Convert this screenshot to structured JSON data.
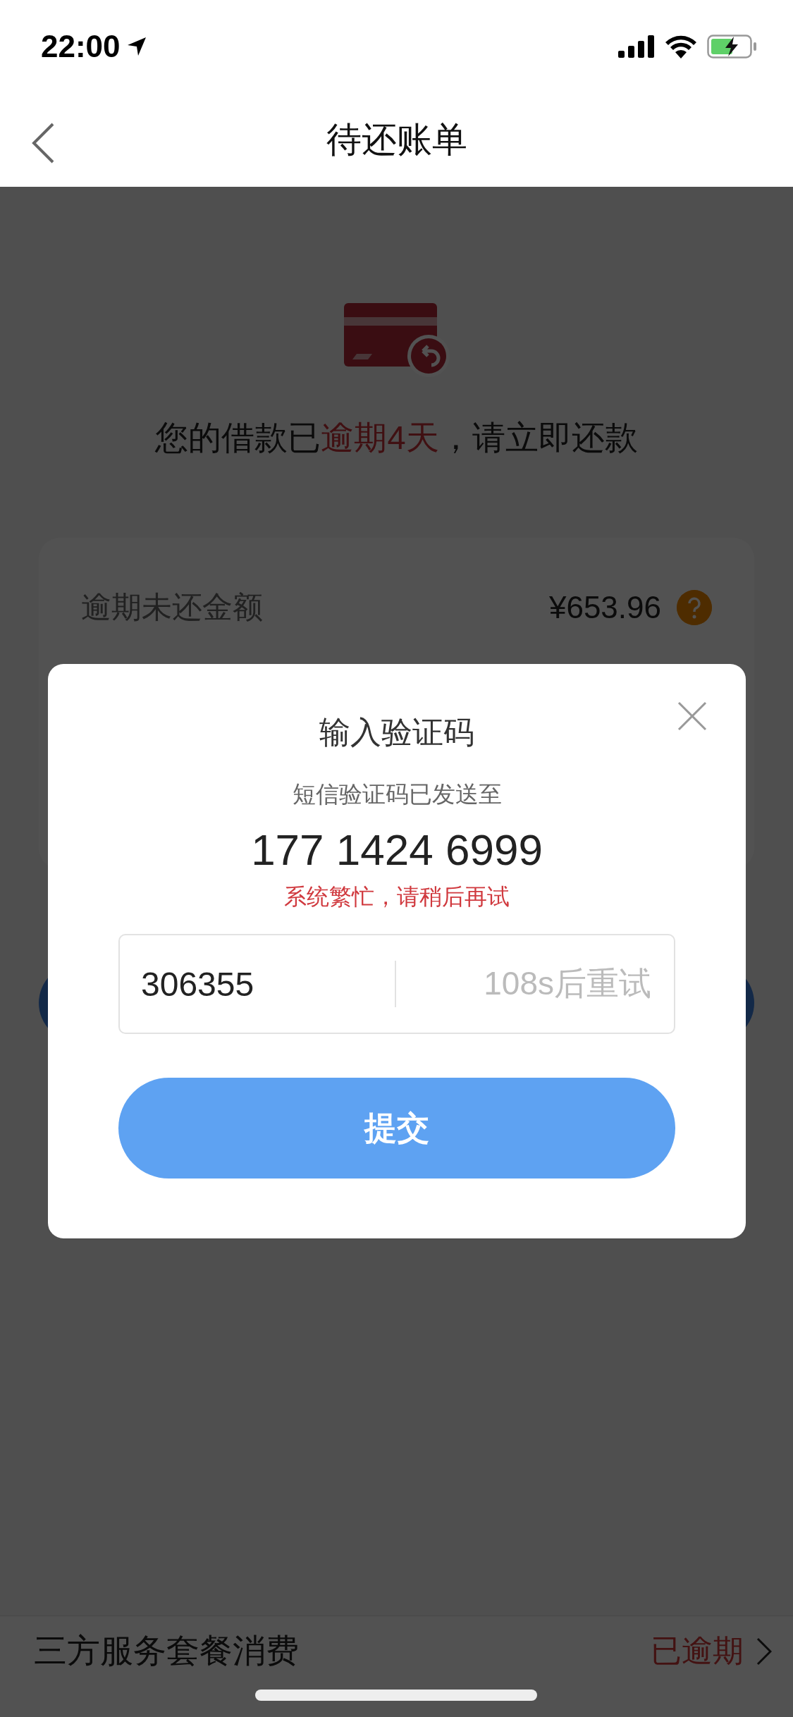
{
  "status_bar": {
    "time": "22:00"
  },
  "nav_bar": {
    "title": "待还账单"
  },
  "notice": {
    "segments": [
      {
        "text": "您的借款已",
        "highlight": false
      },
      {
        "text": "逾期4天",
        "highlight": true
      },
      {
        "text": "，请立即还款",
        "highlight": false
      }
    ]
  },
  "card": {
    "rows": [
      {
        "label": "逾期未还金额",
        "amount": "¥653.96"
      }
    ]
  },
  "dialog": {
    "title": "输入验证码",
    "subtitle": "短信验证码已发送至",
    "phone": "177 1424 6999",
    "error": "系统繁忙，请稍后再试",
    "code_field": {
      "value": "306355"
    },
    "countdown": "108s后重试",
    "submit": "提交"
  },
  "list": [
    {
      "label": "三方服务套餐消费",
      "status": "已逾期"
    }
  ]
}
